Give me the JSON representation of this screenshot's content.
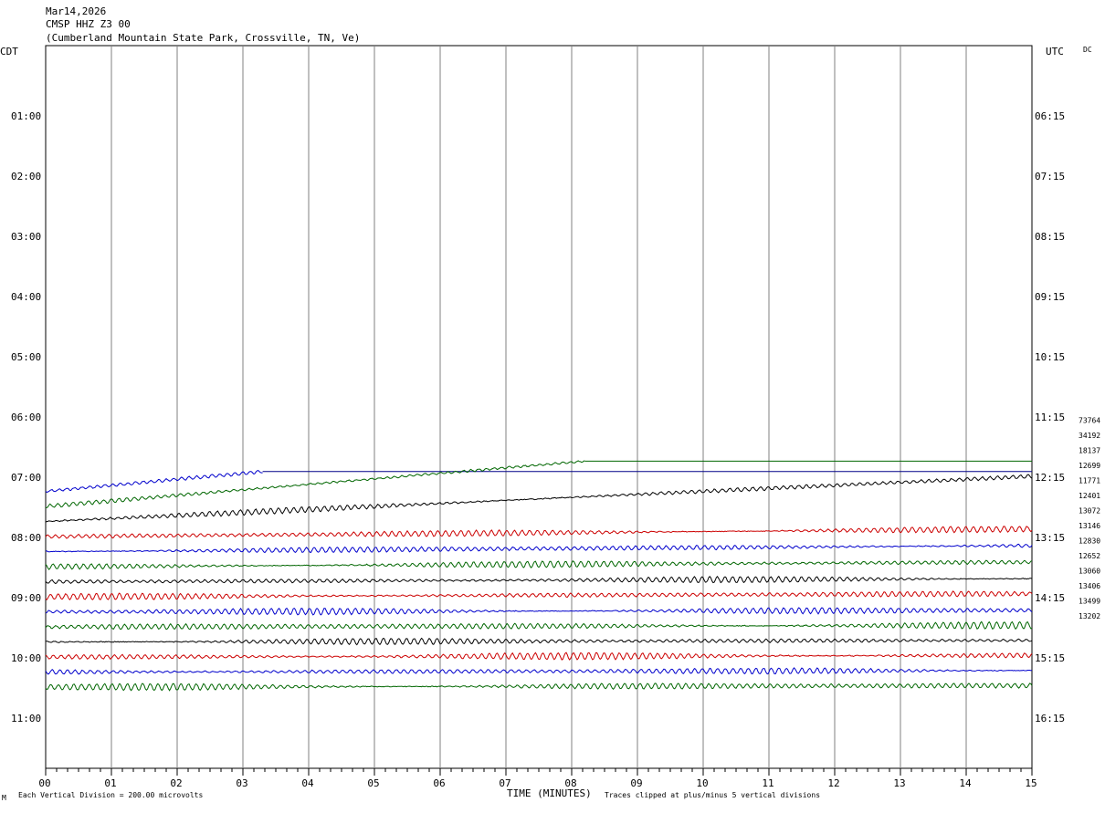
{
  "header": {
    "date": "Mar14,2026",
    "station": "CMSP HHZ Z3 00",
    "location": "(Cumberland Mountain State Park, Crossville, TN, Ve)"
  },
  "left_axis_title": "CDT",
  "right_axis_title": "UTC",
  "corner_tag": "DC",
  "footer": {
    "left": "Each Vertical Division =  200.00 microvolts",
    "center": "TIME (MINUTES)",
    "right": "Traces clipped at plus/minus 5 vertical divisions",
    "corner_mark": "M"
  },
  "chart_data": {
    "type": "line",
    "title": "CMSP HHZ Z3 00",
    "xlabel": "TIME (MINUTES)",
    "x_ticks": [
      "00",
      "01",
      "02",
      "03",
      "04",
      "05",
      "06",
      "07",
      "08",
      "09",
      "10",
      "11",
      "12",
      "13",
      "14",
      "15"
    ],
    "xlim": [
      0,
      15
    ],
    "row_minutes": 15,
    "left_time_labels": [
      "01:00",
      "02:00",
      "03:00",
      "04:00",
      "05:00",
      "06:00",
      "07:00",
      "08:00",
      "09:00",
      "10:00",
      "11:00"
    ],
    "right_time_labels": [
      "06:15",
      "07:15",
      "08:15",
      "09:15",
      "10:15",
      "11:15",
      "12:15",
      "13:15",
      "14:15",
      "15:15",
      "16:15"
    ],
    "label_rows": [
      4,
      8,
      12,
      16,
      20,
      24,
      28,
      32,
      36,
      40,
      44
    ],
    "total_rows": 48,
    "grid": true,
    "series": [
      {
        "row": 29,
        "color": "#0000cc",
        "start_minute": 0,
        "end_minute": 3.3,
        "drift": 6,
        "amp": 2,
        "tail": "#000088"
      },
      {
        "row": 30,
        "color": "#006600",
        "start_minute": 0,
        "end_minute": 8.2,
        "drift": 5.5,
        "amp": 1.8,
        "tail": "#006600"
      },
      {
        "row": 31,
        "color": "#000000",
        "start_minute": 0,
        "end_minute": 15,
        "drift": 3,
        "amp": 2.5
      },
      {
        "row": 32,
        "color": "#cc0000",
        "start_minute": 0,
        "end_minute": 15,
        "drift": 0.5,
        "amp": 3
      },
      {
        "row": 33,
        "color": "#0000cc",
        "start_minute": 0,
        "end_minute": 15,
        "drift": 0.4,
        "amp": 3
      },
      {
        "row": 34,
        "color": "#006600",
        "start_minute": 0,
        "end_minute": 15,
        "drift": 0.3,
        "amp": 3
      },
      {
        "row": 35,
        "color": "#000000",
        "start_minute": 0,
        "end_minute": 15,
        "drift": 0.2,
        "amp": 2.8
      },
      {
        "row": 36,
        "color": "#cc0000",
        "start_minute": 0,
        "end_minute": 15,
        "drift": 0.2,
        "amp": 2.8
      },
      {
        "row": 37,
        "color": "#0000cc",
        "start_minute": 0,
        "end_minute": 15,
        "drift": 0.1,
        "amp": 3.2
      },
      {
        "row": 38,
        "color": "#006600",
        "start_minute": 0,
        "end_minute": 15,
        "drift": 0.1,
        "amp": 3.2
      },
      {
        "row": 39,
        "color": "#000000",
        "start_minute": 0,
        "end_minute": 15,
        "drift": 0.1,
        "amp": 3
      },
      {
        "row": 40,
        "color": "#cc0000",
        "start_minute": 0,
        "end_minute": 15,
        "drift": 0.1,
        "amp": 3.2
      },
      {
        "row": 41,
        "color": "#0000cc",
        "start_minute": 0,
        "end_minute": 15,
        "drift": 0.1,
        "amp": 3
      },
      {
        "row": 42,
        "color": "#006600",
        "start_minute": 0,
        "end_minute": 15,
        "drift": 0.1,
        "amp": 3.2
      }
    ],
    "right_values": [
      "73764",
      "34192",
      "18137",
      "12699",
      "11771",
      "12401",
      "13072",
      "13146",
      "12830",
      "12652",
      "13060",
      "13406",
      "13499",
      "13202"
    ]
  }
}
